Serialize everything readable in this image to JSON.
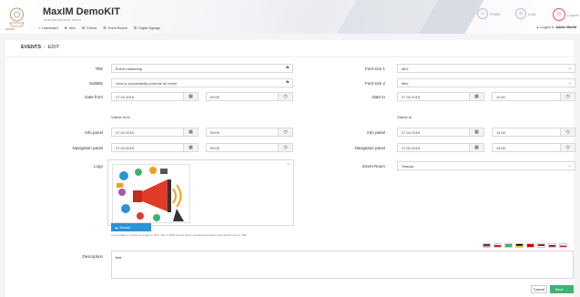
{
  "header": {
    "brand": "MaxIM DemoKIT",
    "brand_sub": "ADMINISTRATION PANEL",
    "logo_text": "MAXIM",
    "nav": [
      {
        "label": "Dashboard",
        "icon": "dashboard-icon"
      },
      {
        "label": "New",
        "icon": "plus-icon"
      },
      {
        "label": "Events",
        "icon": "list-icon"
      },
      {
        "label": "Event Rooms",
        "icon": "list-icon"
      },
      {
        "label": "Digital Signage",
        "icon": "list-icon"
      }
    ],
    "profile_label": "Profile",
    "lock_label": "Lock",
    "logout_label": "Logout",
    "logged_in_prefix": "Logged in:",
    "logged_in_user": "Admin MaxIM"
  },
  "breadcrumb": {
    "section": "EVENTS",
    "page": "EDIT"
  },
  "form": {
    "title_label": "Title",
    "title_value": "Event marketing",
    "subtitle_label": "Subtitle",
    "subtitle_value": "How to successfully promote an event",
    "date_from_label": "Date from",
    "date_from": "27.02.2019",
    "time_from": "09:00",
    "visible_from_label": "Visible from",
    "info_panel_label": "Info panel",
    "info_from_date": "27.02.2019",
    "info_from_time": "09:00",
    "nav_panel_label": "Navigation panel",
    "nav_from_date": "27.02.2019",
    "nav_from_time": "09:00",
    "logo_label": "Logo",
    "upload_label": "Browse",
    "upload_hint": "It is possible to upload an image in JPG, GIF or PNG format. Recommended resolution and max file size is: 2Mb",
    "description_label": "Description",
    "description_value": "test",
    "font_size1_label": "Font size 1",
    "font_size1_value": "Mini",
    "font_size2_label": "Font size 2",
    "font_size2_value": "Mini",
    "date_to_label": "Date to",
    "date_to": "27.02.2019",
    "time_to": "11:00",
    "visible_to_label": "Visible to",
    "info_to_date": "27.02.2019",
    "info_to_time": "14:00",
    "nav_to_date": "27.02.2019",
    "nav_to_time": "14:00",
    "event_room_label": "Event Room",
    "event_room_value": "Strauss"
  },
  "flags": [
    {
      "name": "us-flag",
      "colors": [
        "#b22234",
        "#ffffff",
        "#3c3b6e"
      ]
    },
    {
      "name": "si-flag",
      "colors": [
        "#ffffff",
        "#0056b3",
        "#e3262d"
      ]
    },
    {
      "name": "hr-flag",
      "colors": [
        "#e3262d",
        "#ffffff",
        "#1d3b8f"
      ]
    },
    {
      "name": "de-flag",
      "colors": [
        "#000000",
        "#dd0000",
        "#ffce00"
      ]
    },
    {
      "name": "it-flag",
      "colors": [
        "#009246",
        "#ffffff",
        "#ce2b37"
      ]
    },
    {
      "name": "rs-flag",
      "colors": [
        "#c6363c",
        "#0c4076",
        "#ffffff"
      ]
    },
    {
      "name": "ru-flag",
      "colors": [
        "#ffffff",
        "#0039a6",
        "#d52b1e"
      ]
    },
    {
      "name": "pl-flag",
      "colors": [
        "#ffffff",
        "#ffffff",
        "#dc143c"
      ]
    }
  ],
  "actions": {
    "cancel_label": "Cancel",
    "save_label": "Save"
  },
  "colors": {
    "accent": "#2a93d5",
    "save": "#3cb371",
    "header_icon": "#8a8fb8"
  }
}
